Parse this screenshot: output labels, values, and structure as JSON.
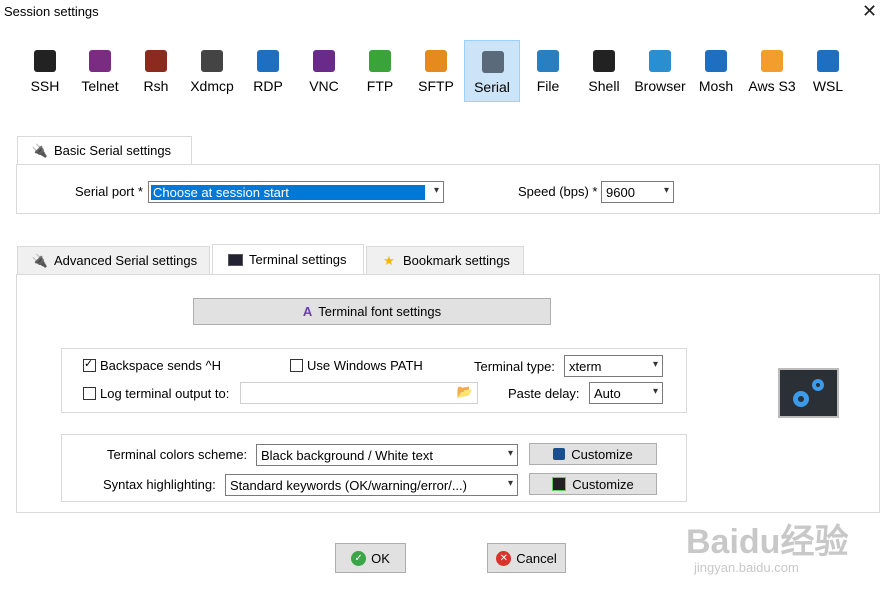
{
  "window": {
    "title": "Session settings",
    "close_glyph": "✕"
  },
  "protocols": [
    {
      "label": "SSH",
      "icon": "key-icon",
      "color": "#222"
    },
    {
      "label": "Telnet",
      "icon": "telnet-icon",
      "color": "#7a2c82"
    },
    {
      "label": "Rsh",
      "icon": "rsh-icon",
      "color": "#8b2b1d"
    },
    {
      "label": "Xdmcp",
      "icon": "xdmcp-icon",
      "color": "#444"
    },
    {
      "label": "RDP",
      "icon": "rdp-icon",
      "color": "#1e6fc0"
    },
    {
      "label": "VNC",
      "icon": "vnc-icon",
      "color": "#6a2a8a"
    },
    {
      "label": "FTP",
      "icon": "ftp-icon",
      "color": "#3aa33a"
    },
    {
      "label": "SFTP",
      "icon": "sftp-icon",
      "color": "#e58a1c"
    },
    {
      "label": "Serial",
      "icon": "serial-plug-icon",
      "color": "#5a6a7a"
    },
    {
      "label": "File",
      "icon": "file-monitor-icon",
      "color": "#2a7fc0"
    },
    {
      "label": "Shell",
      "icon": "shell-icon",
      "color": "#222"
    },
    {
      "label": "Browser",
      "icon": "globe-icon",
      "color": "#2a8fd0"
    },
    {
      "label": "Mosh",
      "icon": "satellite-icon",
      "color": "#1e6fc0"
    },
    {
      "label": "Aws S3",
      "icon": "aws-cubes-icon",
      "color": "#f29d2c"
    },
    {
      "label": "WSL",
      "icon": "windows-icon",
      "color": "#1e6fc0"
    }
  ],
  "active_protocol": "Serial",
  "basic": {
    "tab_label": "Basic Serial settings",
    "port_label": "Serial port *",
    "port_value": "Choose at session start",
    "speed_label": "Speed (bps) *",
    "speed_value": "9600"
  },
  "tabs": {
    "advanced": "Advanced Serial settings",
    "terminal": "Terminal settings",
    "bookmark": "Bookmark settings"
  },
  "terminal": {
    "font_button": "Terminal font settings",
    "backspace_label": "Backspace sends ^H",
    "backspace_checked": true,
    "winpath_label": "Use Windows PATH",
    "winpath_checked": false,
    "type_label": "Terminal type:",
    "type_value": "xterm",
    "log_label": "Log terminal output to:",
    "log_checked": false,
    "log_value": "",
    "paste_label": "Paste delay:",
    "paste_value": "Auto",
    "colors_label": "Terminal colors scheme:",
    "colors_value": "Black background / White text",
    "customize_label": "Customize",
    "syntax_label": "Syntax highlighting:",
    "syntax_value": "Standard keywords (OK/warning/error/...)",
    "customize2_label": "Customize"
  },
  "footer": {
    "ok": "OK",
    "cancel": "Cancel"
  },
  "watermark": {
    "brand": "Baidu经验",
    "url": "jingyan.baidu.com"
  }
}
